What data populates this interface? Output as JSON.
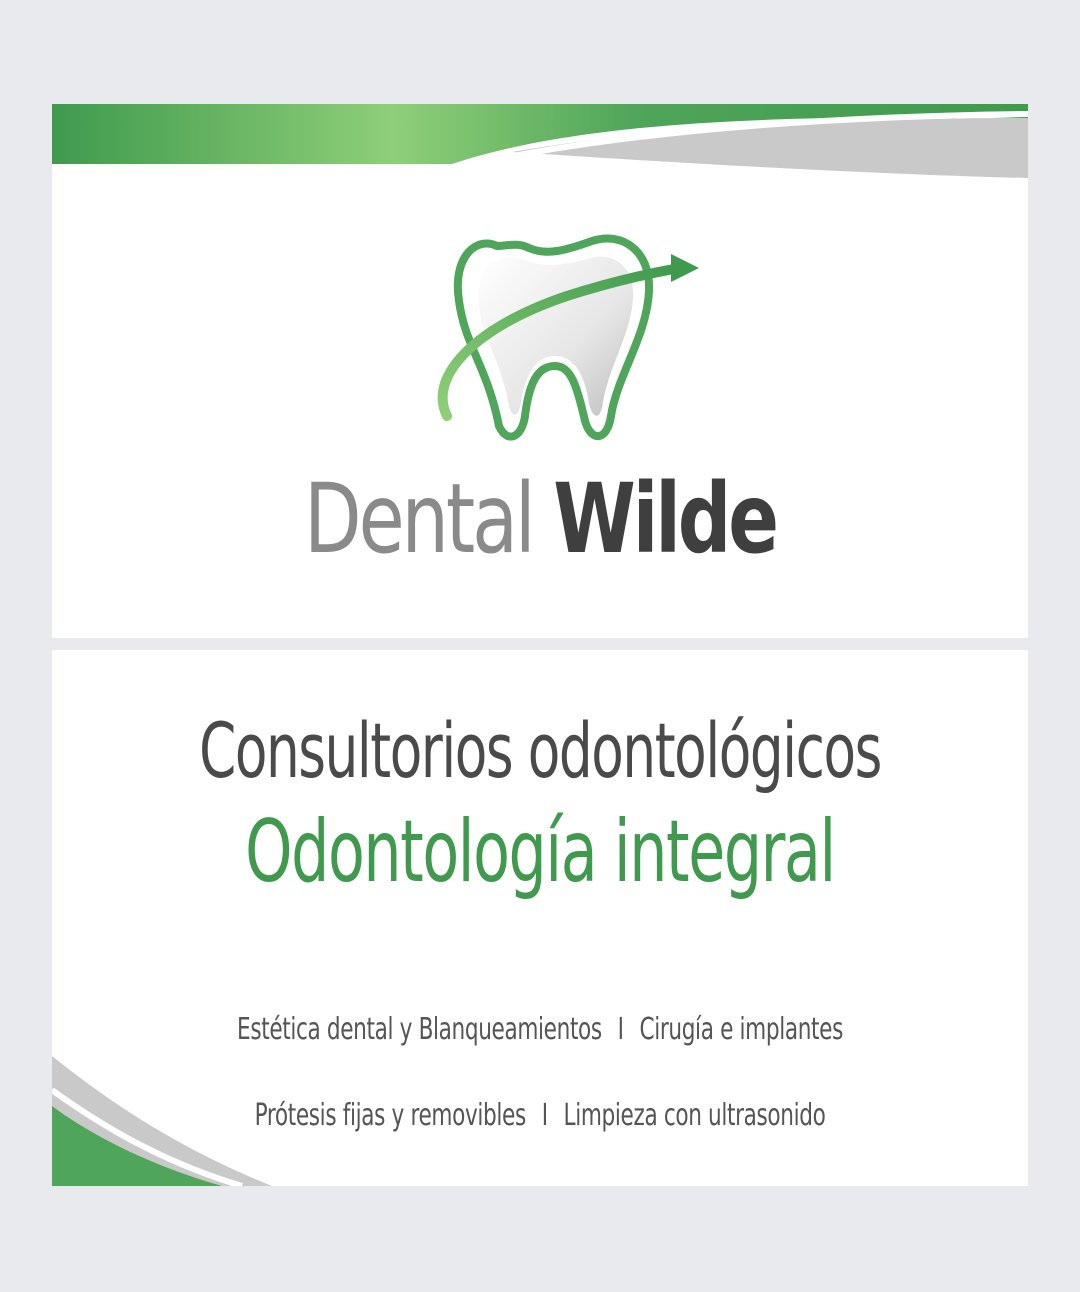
{
  "brand": {
    "name_light": "Dental",
    "name_dark": "Wilde"
  },
  "headline": {
    "line1": "Consultorios  odontológicos",
    "line2": "Odontología  integral"
  },
  "services": {
    "row1": {
      "left": "Estética dental  y  Blanqueamientos",
      "separator": "I",
      "right": "Cirugía  e  implantes"
    },
    "row2": {
      "left": "Prótesis fijas  y  removibles",
      "separator": "I",
      "right": "Limpieza con ultrasonido"
    }
  },
  "colors": {
    "green": "#3f9a4e",
    "light_green": "#7fbf6a",
    "gray": "#8a8a8a",
    "dark_gray": "#3f3f3f",
    "background": "#e9eaee"
  },
  "icons": {
    "logo": "tooth-with-arrow-icon"
  }
}
